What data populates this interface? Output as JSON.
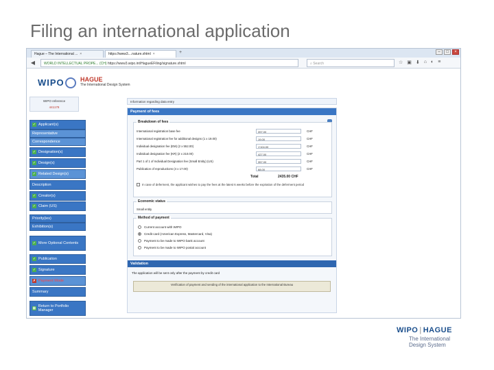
{
  "slide": {
    "title": "Filing an international application"
  },
  "browser": {
    "tabs": [
      {
        "label": "Hague – The International ...",
        "active": false
      },
      {
        "label": "https://www3....nature.xhtml",
        "active": true
      }
    ],
    "new_tab": "+",
    "url_site": "WORLD INTELLECTUAL PROPE... (CH)",
    "url_path": "https://www3.wipo.int/HagueEFiling/signature.xhtml",
    "search_placeholder": "Search",
    "window_controls": [
      "–",
      "□",
      "×"
    ]
  },
  "page": {
    "wipo_logo": "WIPO",
    "hague_logo": "HAGUE",
    "hague_sub": "The International Design System",
    "ref_label": "WIPO reference",
    "ref_number": "441178",
    "info_bar": "Information regarding data entry",
    "sidebar": [
      {
        "label": "Applicant(s)",
        "check": true,
        "sub": false
      },
      {
        "label": "Representative",
        "check": false,
        "sub": true
      },
      {
        "label": "Correspondence",
        "check": false,
        "sub": true
      },
      {
        "label": "Designation(s)",
        "check": true,
        "sub": false
      },
      {
        "label": "Design(s)",
        "check": true,
        "sub": false
      },
      {
        "label": "Related Design(s)",
        "check": true,
        "sub": true
      },
      {
        "label": "Description",
        "check": false,
        "sub": false
      },
      {
        "label": "Creator(s)",
        "check": true,
        "sub": false
      },
      {
        "label": "Claim (US)",
        "check": true,
        "sub": false
      },
      {
        "label": "Priority(ies)",
        "check": false,
        "sub": false
      },
      {
        "label": "Exhibition(s)",
        "check": false,
        "sub": false
      },
      {
        "label": "More Optional Contents",
        "check": true,
        "sub": false
      },
      {
        "label": "Publication",
        "check": true,
        "sub": false
      },
      {
        "label": "Signature",
        "check": true,
        "sub": false
      },
      {
        "label": "Payment Mode",
        "check": false,
        "sub": false,
        "warn": true
      },
      {
        "label": "Summary",
        "check": false,
        "sub": false
      },
      {
        "label": "Return to Portfolio Manager",
        "check": false,
        "sub": false
      }
    ],
    "payment": {
      "header": "Payment of fees",
      "breakdown_legend": "Breakdown of fees",
      "fees": [
        {
          "label": "International registration base fee",
          "value": "397.00",
          "currency": "CHF"
        },
        {
          "label": "International registration fee for additional designs (1 x 19.00)",
          "value": "19.00",
          "currency": "CHF"
        },
        {
          "label": "Individual designation fee (EM) (2 x 552.00)",
          "value": "1'104.00",
          "currency": "CHF"
        },
        {
          "label": "Individual designation fee (KR) (2 x 210.00)",
          "value": "427.00",
          "currency": "CHF"
        },
        {
          "label": "Part 1 of 1 of Individual Designation fee (Small Entity) (US)",
          "value": "357.00",
          "currency": "CHF"
        },
        {
          "label": "Publication of reproductions (4 x 17.00)",
          "value": "68.00",
          "currency": "CHF"
        }
      ],
      "total_label": "Total",
      "total_value": "2435.00 CHF",
      "deferment_text": "In case of deferment, the applicant wishes to pay the fees at the latest 6 weeks before the expiration of the deferment period",
      "economic_legend": "Economic status",
      "economic_value": "Small entity",
      "method_legend": "Method of payment",
      "methods": [
        {
          "label": "Current account with WIPO",
          "selected": false
        },
        {
          "label": "Credit card (American Express, Mastercard, Visa)",
          "selected": true
        },
        {
          "label": "Payment to be made to WIPO bank account",
          "selected": false
        },
        {
          "label": "Payment to be made to WIPO postal account",
          "selected": false
        }
      ]
    },
    "validation": {
      "header": "Validation",
      "message": "The application will be sent only after the payment by credit card",
      "box_text": "Verification of payment and sending of the international application to the International Bureau"
    }
  },
  "footer": {
    "wipo": "WIPO",
    "sep": "|",
    "hague": "HAGUE",
    "sub": "The International Design System"
  }
}
